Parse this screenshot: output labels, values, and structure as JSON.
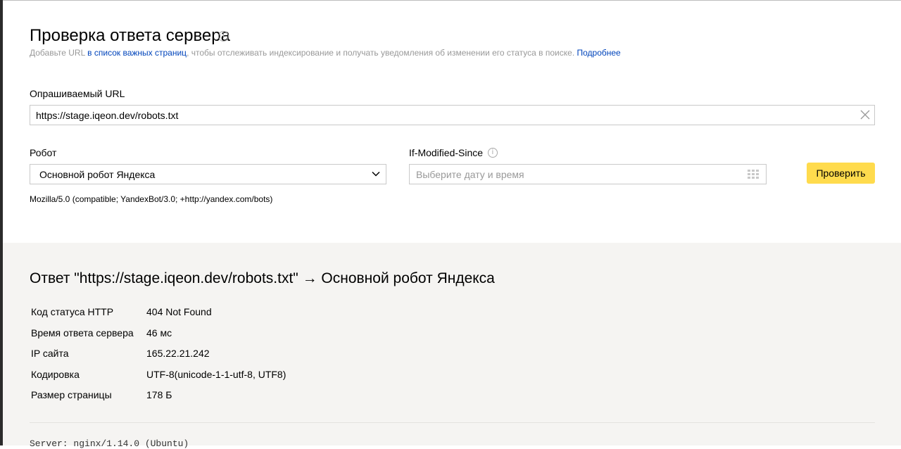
{
  "header": {
    "title": "Проверка ответа сервера",
    "info_icon": "info-icon",
    "subtitle_prefix": "Добавьте URL ",
    "subtitle_link": "в список важных страниц",
    "subtitle_middle": ", чтобы отслеживать индексирование и получать уведомления об изменении его статуса в поиске. ",
    "more_link": "Подробнее"
  },
  "form": {
    "url_label": "Опрашиваемый URL",
    "url_value": "https://stage.iqeon.dev/robots.txt",
    "robot_label": "Робот",
    "robot_selected": "Основной робот Яндекса",
    "ims_label": "If-Modified-Since",
    "date_placeholder": "Выберите дату и время",
    "submit_label": "Проверить",
    "user_agent": "Mozilla/5.0 (compatible; YandexBot/3.0; +http://yandex.com/bots)"
  },
  "result": {
    "title": "Ответ \"https://stage.iqeon.dev/robots.txt\" → Основной робот Яндекса",
    "rows": [
      {
        "key": "Код статуса HTTP",
        "value": "404 Not Found"
      },
      {
        "key": "Время ответа сервера",
        "value": "46 мс"
      },
      {
        "key": "IP сайта",
        "value": "165.22.21.242"
      },
      {
        "key": "Кодировка",
        "value": "UTF-8(unicode-1-1-utf-8, UTF8)"
      },
      {
        "key": "Размер страницы",
        "value": "178 Б"
      }
    ],
    "raw_header": "Server: nginx/1.14.0 (Ubuntu)"
  },
  "colors": {
    "accent_button": "#ffdb4d",
    "link": "#0044bb",
    "result_bg": "#f5f4f2"
  }
}
